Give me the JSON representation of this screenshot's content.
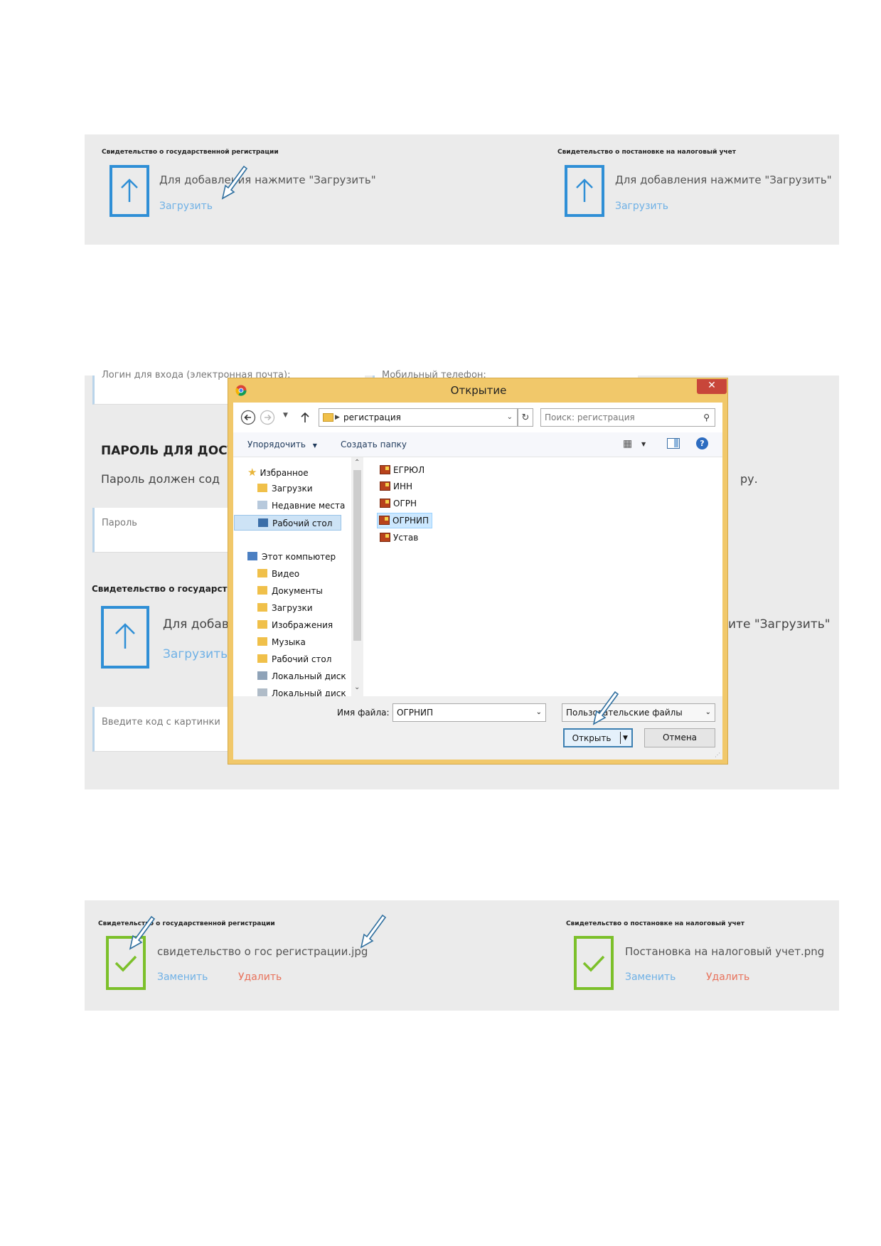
{
  "panel_upload": {
    "left_title": "Свидетельство о государственной регистрации",
    "right_title": "Свидетельство о постановке на налоговый учет",
    "hint": "Для добавления нажмите \"Загрузить\"",
    "upload_link": "Загрузить"
  },
  "background_page": {
    "login_label": "Логин для входа (электронная почта):",
    "phone_label": "Мобильный телефон:",
    "password_heading": "ПАРОЛЬ ДЛЯ ДОСТ",
    "password_hint": "Пароль должен сод",
    "password_hint_tail": "ру.",
    "password_placeholder": "Пароль",
    "cert_title": "Свидетельство о государст",
    "hint_fragment": "Для добав",
    "hint_tail": "ите \"Загрузить\"",
    "upload_link": "Загрузить",
    "captcha_placeholder": "Введите код с картинки"
  },
  "dialog": {
    "title": "Открытие",
    "path_folder": "регистрация",
    "search_placeholder": "Поиск: регистрация",
    "toolbar": {
      "organize": "Упорядочить",
      "new_folder": "Создать папку"
    },
    "favorites_header": "Избранное",
    "favorites": [
      "Загрузки",
      "Недавние места",
      "Рабочий стол"
    ],
    "computer_header": "Этот компьютер",
    "computer_items": [
      "Видео",
      "Документы",
      "Загрузки",
      "Изображения",
      "Музыка",
      "Рабочий стол",
      "Локальный диск",
      "Локальный диск"
    ],
    "files": [
      "ЕГРЮЛ",
      "ИНН",
      "ОГРН",
      "ОГРНИП",
      "Устав"
    ],
    "selected_file": "ОГРНИП",
    "filename_label": "Имя файла:",
    "filename_value": "ОГРНИП",
    "filetype_value": "Пользовательские файлы",
    "open_button": "Открыть",
    "cancel_button": "Отмена"
  },
  "panel_done": {
    "left_title": "Свидетельство о государственной регистрации",
    "right_title": "Свидетельство о постановке на налоговый учет",
    "left_file": "свидетельство о гос регистрации.jpg",
    "right_file": "Постановка на налоговый учет.png",
    "replace_link": "Заменить",
    "delete_link": "Удалить"
  },
  "colors": {
    "upload_blue": "#2f8fd6",
    "ok_green": "#7cc02a",
    "link_blue": "#6fb1e6",
    "link_red": "#e8715a",
    "dialog_frame": "#f1c86a"
  }
}
